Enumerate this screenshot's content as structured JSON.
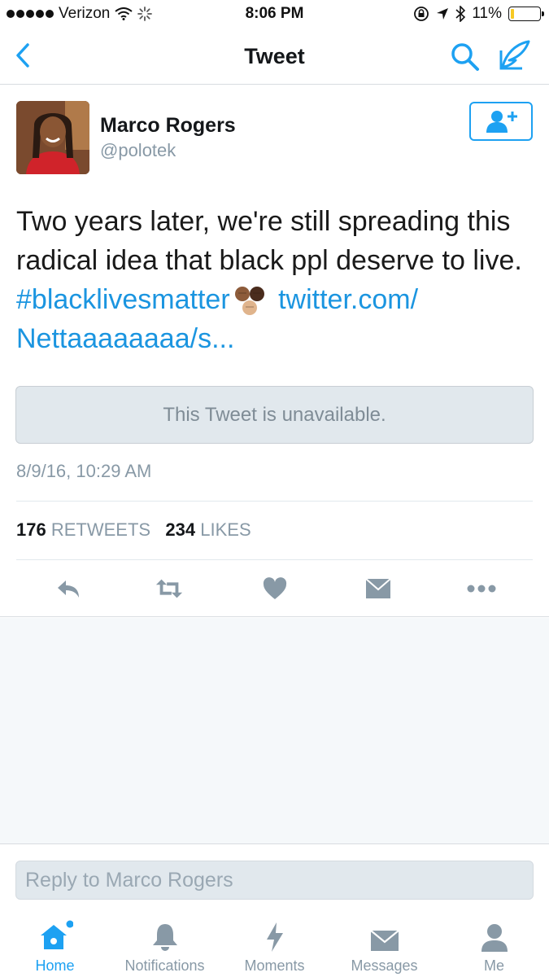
{
  "status_bar": {
    "carrier": "Verizon",
    "time": "8:06 PM",
    "battery_percent": "11%",
    "battery_level": 0.11
  },
  "nav": {
    "title": "Tweet"
  },
  "tweet": {
    "author_name": "Marco Rogers",
    "author_handle": "@polotek",
    "text_line1": "Two years later, we're still spreading this",
    "text_line2": "radical idea that black ppl deserve to live.",
    "hashtag": "#blacklivesmatter",
    "link_part1": "twitter.com/",
    "link_part2": "Nettaaaaaaaa/s...",
    "quoted_unavailable": "This Tweet is unavailable.",
    "timestamp": "8/9/16, 10:29 AM",
    "retweet_count": "176",
    "retweet_label": "RETWEETS",
    "like_count": "234",
    "like_label": "LIKES"
  },
  "reply": {
    "placeholder": "Reply to Marco Rogers"
  },
  "tabs": [
    {
      "label": "Home",
      "icon": "home-icon",
      "active": true
    },
    {
      "label": "Notifications",
      "icon": "bell-icon",
      "active": false
    },
    {
      "label": "Moments",
      "icon": "lightning-icon",
      "active": false
    },
    {
      "label": "Messages",
      "icon": "envelope-icon",
      "active": false
    },
    {
      "label": "Me",
      "icon": "person-icon",
      "active": false
    }
  ],
  "colors": {
    "accent": "#1da1f2",
    "link": "#1b95e0",
    "muted": "#8899a6",
    "icon_gray": "#8899a6",
    "battery": "#f7c924"
  }
}
